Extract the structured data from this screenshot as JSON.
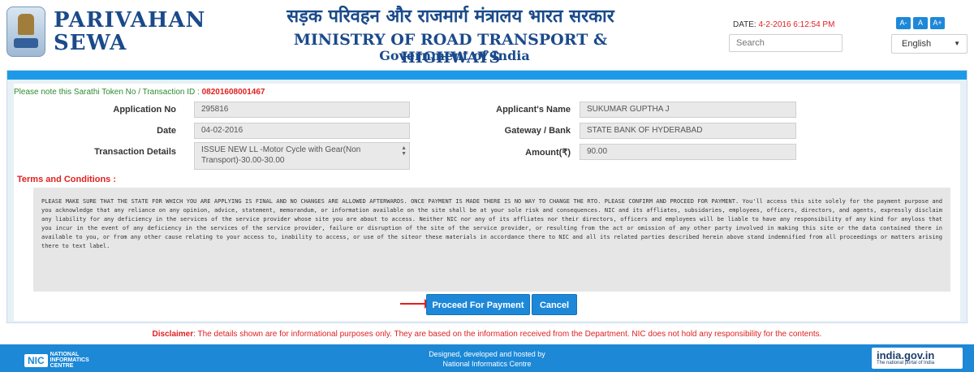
{
  "header": {
    "brand_line1": "PARIVAHAN",
    "brand_line2": "SEWA",
    "hindi_title": "सड़क परिवहन और राजमार्ग मंत्रालय भारत सरकार",
    "ministry": "MINISTRY OF ROAD TRANSPORT & HIGHWAYS",
    "government": "Government of India",
    "date_prefix": "DATE: ",
    "date_value": "4-2-2016 6:12:54 PM",
    "search_placeholder": "Search",
    "font_buttons": [
      "A-",
      "A",
      "A+"
    ],
    "language": "English"
  },
  "token": {
    "prefix": "Please note this Sarathi Token No / Transaction ID : ",
    "id": "08201608001467"
  },
  "form": {
    "application_no_label": "Application No",
    "application_no": "295816",
    "date_label": "Date",
    "date": "04-02-2016",
    "transaction_label": "Transaction Details",
    "transaction": "ISSUE NEW LL   -Motor Cycle with Gear(Non Transport)-30.00-30.00",
    "applicant_label": "Applicant's Name",
    "applicant": "SUKUMAR GUPTHA J",
    "gateway_label": "Gateway / Bank",
    "gateway": "STATE BANK OF HYDERABAD",
    "amount_label": "Amount(₹)",
    "amount": "90.00"
  },
  "terms": {
    "title": "Terms and Conditions :",
    "text": "PLEASE MAKE SURE THAT THE STATE FOR WHICH YOU ARE APPLYING IS FINAL AND NO CHANGES ARE ALLOWED AFTERWARDS. ONCE PAYMENT IS MADE THERE IS NO WAY TO CHANGE THE RTO. PLEASE CONFIRM AND PROCEED FOR PAYMENT. You'll access this site solely for the payment purpose and you acknowledge that any reliance on any opinion, advice, statement, memorandum, or information available on the site shall be at your sole risk and consequences. NIC and its affliates, subsidaries, employees, officers, directors, and agents, expressly disclaim any liability for any deficiency in the services of the service provider whose site you are about to access. Neither NIC nor any of its affliates nor their directors, officers and employees will be liable to have any responsibility of any kind for anyloss that you incur in the event of any deficiency in the services of the service provider, failure or disruption of the site of the service provider, or resulting from the act or omission of any other party involved in making this site or the data contained there in available to you, or from any other cause relating to your access to, inability to access, or use of the siteor these materials in accordance there to NIC and all its related parties described herein above stand indemnified from all proceedings or matters arising there to text label."
  },
  "actions": {
    "pay_label": "Proceed For Payment",
    "cancel_label": "Cancel"
  },
  "disclaimer": {
    "label": "Disclaimer",
    "text": ": The details shown are for informational purposes only. They are based on the information received from the Department. NIC does not hold any responsibility for the contents."
  },
  "footer": {
    "nic_box": "NIC",
    "nic_line1": "NATIONAL",
    "nic_line2": "INFORMATICS",
    "nic_line3": "CENTRE",
    "designed_line1": "Designed, developed and hosted by",
    "designed_line2": "National Informatics Centre",
    "portal_name": "india.gov.in",
    "portal_tag": "The national portal of India"
  }
}
